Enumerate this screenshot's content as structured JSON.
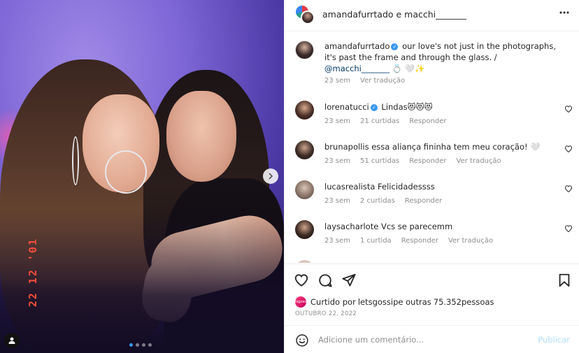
{
  "photo": {
    "datestamp": "22 12 '01",
    "carousel_dots": 4,
    "active_dot": 0
  },
  "header": {
    "title": "amandafurrtado e macchi_______"
  },
  "caption": {
    "user": "amandafurrtado",
    "text": " our love's not just in the photographs, it's past the frame and through the glass. / ",
    "mention": "@macchi_______",
    "emoji": " 💍 🤍✨",
    "time": "23 sem",
    "translate": "Ver tradução"
  },
  "comments": [
    {
      "user": "lorenatucci",
      "verified": true,
      "text": " Lindas😻😻😻",
      "time": "23 sem",
      "likes": "21 curtidas",
      "reply": "Responder",
      "translate": ""
    },
    {
      "user": "brunapollis",
      "verified": false,
      "text": " essa aliança fininha tem meu coração! 🤍",
      "time": "23 sem",
      "likes": "51 curtidas",
      "reply": "Responder",
      "translate": "Ver tradução"
    },
    {
      "user": "lucasrealista",
      "verified": false,
      "text": " Felicidadessss",
      "time": "23 sem",
      "likes": "2 curtidas",
      "reply": "Responder",
      "translate": ""
    },
    {
      "user": "laysacharlote",
      "verified": false,
      "text": " Vcs se parecemm",
      "time": "23 sem",
      "likes": "1 curtida",
      "reply": "Responder",
      "translate": "Ver tradução"
    }
  ],
  "likes": {
    "prefix": "Curtido por ",
    "user": "letsgossip",
    "suffix": " e outras ",
    "count": "75.352",
    "people": " pessoas"
  },
  "post_date": "OUTUBRO 22, 2022",
  "comment_box": {
    "placeholder": "Adicione um comentário...",
    "publish": "Publicar"
  },
  "colors": {
    "link": "#00376b",
    "verified": "#3897f0",
    "publish_disabled": "#b2dffc",
    "muted": "#8e8e8e"
  }
}
